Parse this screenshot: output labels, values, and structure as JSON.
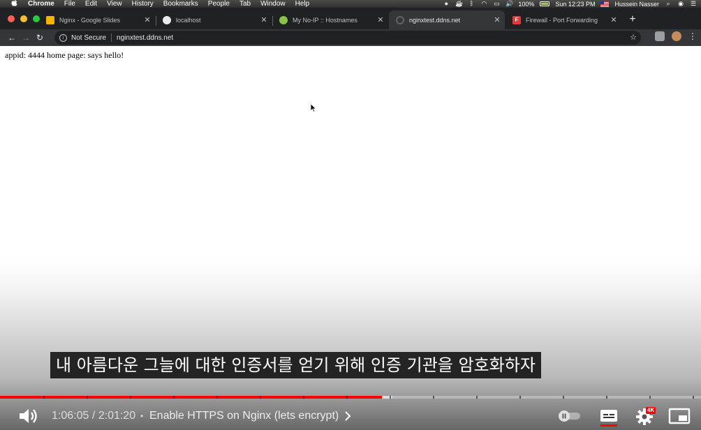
{
  "menubar": {
    "app_name": "Chrome",
    "items": [
      "File",
      "Edit",
      "View",
      "History",
      "Bookmarks",
      "People",
      "Tab",
      "Window",
      "Help"
    ],
    "battery": "100%",
    "clock": "Sun 12:23 PM",
    "user": "Hussein Nasser"
  },
  "tabs": [
    {
      "title": "Nginx - Google Slides",
      "icon": "google-slides-icon",
      "color": "#f4b400",
      "glyph": ""
    },
    {
      "title": "localhost",
      "icon": "globe-icon",
      "color": "#e8eaed",
      "glyph": ""
    },
    {
      "title": "My No-IP :: Hostnames",
      "icon": "noip-icon",
      "color": "#8bc34a",
      "glyph": ""
    },
    {
      "title": "nginxtest.ddns.net",
      "icon": "loading-icon",
      "color": "#5f6368",
      "glyph": "",
      "active": true
    },
    {
      "title": "Firewall - Port Forwarding",
      "icon": "f-logo-icon",
      "color": "#e53935",
      "glyph": "F"
    }
  ],
  "toolbar": {
    "security": "Not Secure",
    "url": "nginxtest.ddns.net"
  },
  "page": {
    "content": "appid: 4444 home page: says hello!"
  },
  "player": {
    "caption": "내 아름다운 그늘에 대한 인증서를 얻기 위해 인증 기관을 암호화하자",
    "time": "1:06:05 / 2:01:20",
    "separator": "•",
    "chapter": "Enable HTTPS on Nginx (lets encrypt)",
    "played_fraction": 0.545,
    "loaded_fraction": 0.56,
    "quality_badge": "4K",
    "accent": "#ff0000"
  }
}
